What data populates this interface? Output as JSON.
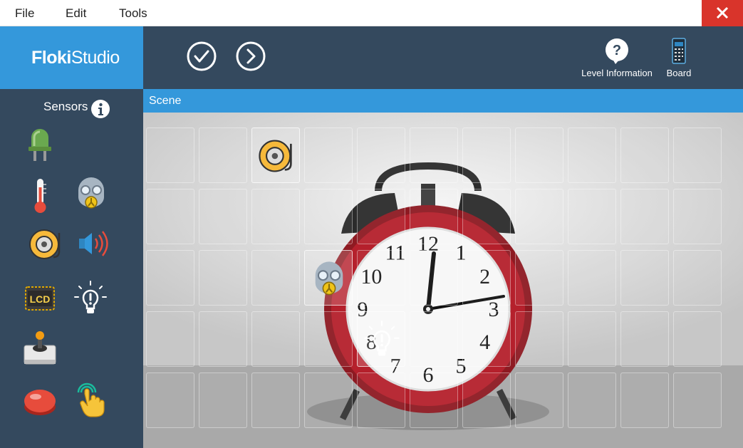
{
  "menu": {
    "file": "File",
    "edit": "Edit",
    "tools": "Tools"
  },
  "brand": {
    "part1": "Floki",
    "part2": "Studio",
    "color": "#3498db"
  },
  "toolbar": {
    "level_info_label": "Level Information",
    "board_label": "Board"
  },
  "sidebar": {
    "heading": "Sensors",
    "items": [
      "led-icon",
      "thermometer-icon",
      "gas-mask-icon",
      "alarm-bell-icon",
      "speaker-icon",
      "lcd-icon",
      "light-bulb-icon",
      "joystick-icon",
      "push-button-icon",
      "touch-icon"
    ],
    "lcd_text": "LCD"
  },
  "scene": {
    "title": "Scene",
    "grid": {
      "rows": 5,
      "cols": 11
    },
    "placed_items": [
      {
        "icon": "alarm-bell-icon",
        "row": 0,
        "col": 2
      },
      {
        "icon": "gas-mask-icon",
        "row": 2,
        "col": 3
      },
      {
        "icon": "light-bulb-icon",
        "row": 3,
        "col": 4
      }
    ],
    "clock_numbers": [
      "12",
      "1",
      "2",
      "3",
      "4",
      "5",
      "6",
      "7",
      "8",
      "9",
      "10",
      "11"
    ]
  },
  "colors": {
    "header_dark": "#34495e",
    "accent_blue": "#3498db",
    "close_red": "#d9342b"
  }
}
